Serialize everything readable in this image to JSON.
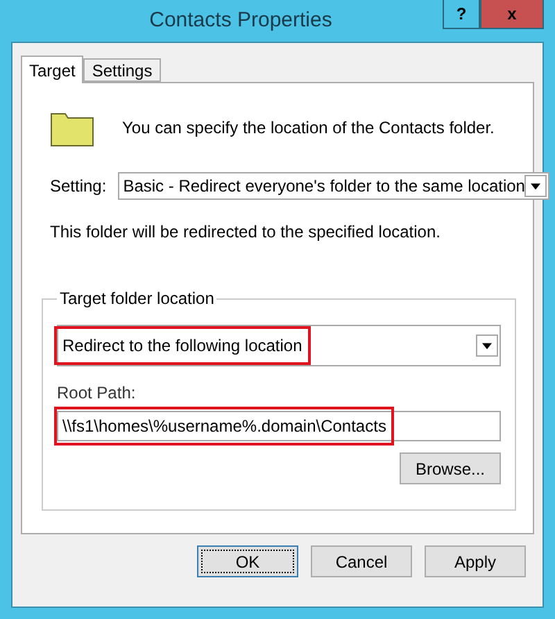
{
  "window": {
    "title": "Contacts Properties",
    "buttons": [
      {
        "kind": "help",
        "label": "?"
      },
      {
        "kind": "close",
        "label": "x"
      }
    ]
  },
  "tabs": [
    {
      "label": "Target",
      "selected": true
    },
    {
      "label": "Settings",
      "selected": false
    }
  ],
  "intro": "You can specify the location of the Contacts folder.",
  "setting": {
    "label": "Setting:",
    "value": "Basic - Redirect everyone's folder to the same location"
  },
  "note": "This folder will be redirected to the specified location.",
  "target_group": {
    "title": "Target folder location",
    "location": {
      "value": "Redirect to the following location",
      "highlighted": true
    },
    "root_path": {
      "label": "Root Path:",
      "value": "\\\\fs1\\homes\\%username%.domain\\Contacts",
      "highlighted": true
    },
    "browse": "Browse..."
  },
  "buttons": [
    {
      "label": "OK",
      "focused": true
    },
    {
      "label": "Cancel",
      "focused": false
    },
    {
      "label": "Apply",
      "focused": false
    }
  ]
}
